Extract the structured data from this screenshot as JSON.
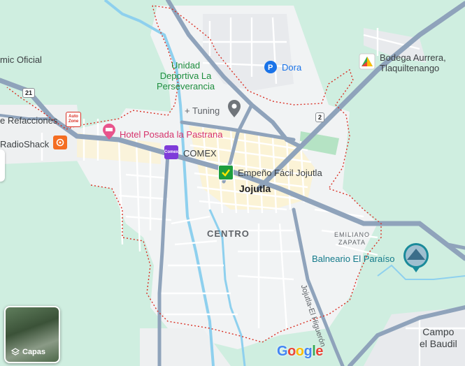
{
  "map": {
    "places": {
      "mic_oficial": "mic Oficial",
      "refacciones": "e Refacciones",
      "radioshack": "RadioShack",
      "hotel": "Hotel Posada la Pastrana",
      "comex": "COMEX",
      "empeno": "Empeño Fácil Jojutla",
      "tuning": "+ Tuning",
      "dora": "Dora",
      "bodega_line1": "Bodega Aurrera,",
      "bodega_line2": "Tlaquiltenango",
      "balneario": "Balneario El Paraíso"
    },
    "park": [
      "Unidad",
      "Deportiva La",
      "Perseverancia"
    ],
    "city": "Jojutla",
    "district": "CENTRO",
    "neighborhood": [
      "EMILIANO",
      "ZAPATA"
    ],
    "campo": [
      "Campo",
      "el Baudil"
    ],
    "street": "Jojutla-El Higuerón",
    "shields": {
      "left": "21",
      "right": "2"
    },
    "poi_labels": {
      "autozone": "Auto Zone",
      "comex": "Comex"
    }
  },
  "controls": {
    "layers_label": "Capas"
  },
  "brand": {
    "letters": [
      "G",
      "o",
      "o",
      "g",
      "l",
      "e"
    ],
    "colors": [
      "#4285F4",
      "#EA4335",
      "#FBBC05",
      "#4285F4",
      "#34A853",
      "#EA4335"
    ]
  },
  "colors": {
    "green_area": "#cfeee0",
    "urban": "#f1f3f4",
    "water": "#8ed0ee",
    "road_major": "#8fa3bb",
    "road_minor": "#ffffff",
    "boundary": "#d93025",
    "center_highlight": "#fdf2d0"
  }
}
